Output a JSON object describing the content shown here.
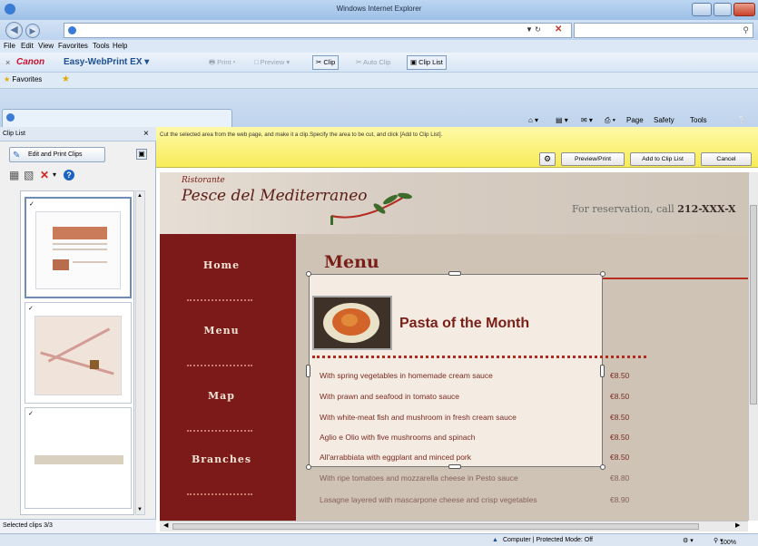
{
  "window": {
    "title": "Windows Internet Explorer"
  },
  "menu": [
    "File",
    "Edit",
    "View",
    "Favorites",
    "Tools",
    "Help"
  ],
  "canon_toolbar": {
    "brand": "Canon",
    "product": "Easy-WebPrint EX",
    "print": "Print",
    "preview": "Preview",
    "clip": "Clip",
    "auto_clip": "Auto Clip",
    "clip_list": "Clip List"
  },
  "favorites_bar": {
    "label": "Favorites"
  },
  "command_bar": [
    "Page",
    "Safety",
    "Tools"
  ],
  "clip_panel": {
    "title": "Clip List",
    "edit_button": "Edit and Print Clips",
    "status": "Selected clips 3/3"
  },
  "clip_bar": {
    "instruction": "Cut the selected area from the web page, and make it a clip.Specify the area to be cut, and click [Add to Clip List].",
    "preview_print": "Preview/Print",
    "add": "Add to Clip List",
    "cancel": "Cancel"
  },
  "webpage": {
    "ristorante": "Ristorante",
    "logo": "Pesce del Mediterraneo",
    "reservation_prefix": "For reservation, call",
    "reservation_phone": "212-XXX-X",
    "nav": [
      "Home",
      "Menu",
      "Map",
      "Branches"
    ],
    "menu_title": "Menu",
    "feature_title": "Pasta of the Month",
    "items": [
      {
        "name": "With spring vegetables in homemade cream sauce",
        "price": "€8.50"
      },
      {
        "name": "With prawn and seafood in tomato sauce",
        "price": "€8.50"
      },
      {
        "name": "With white-meat fish and mushroom in fresh cream sauce",
        "price": "€8.50"
      },
      {
        "name": "Aglio e Olio with five mushrooms and spinach",
        "price": "€8.50"
      },
      {
        "name": "All'arrabbiata with eggplant and minced pork",
        "price": "€8.50"
      },
      {
        "name": "With ripe tomatoes and mozzarella cheese in Pesto sauce",
        "price": "€8.80"
      },
      {
        "name": "Lasagne layered with mascarpone cheese and crisp vegetables",
        "price": "€8.90"
      }
    ]
  },
  "status_bar": {
    "zone": "Computer | Protected Mode: Off",
    "zoom": "100%"
  }
}
